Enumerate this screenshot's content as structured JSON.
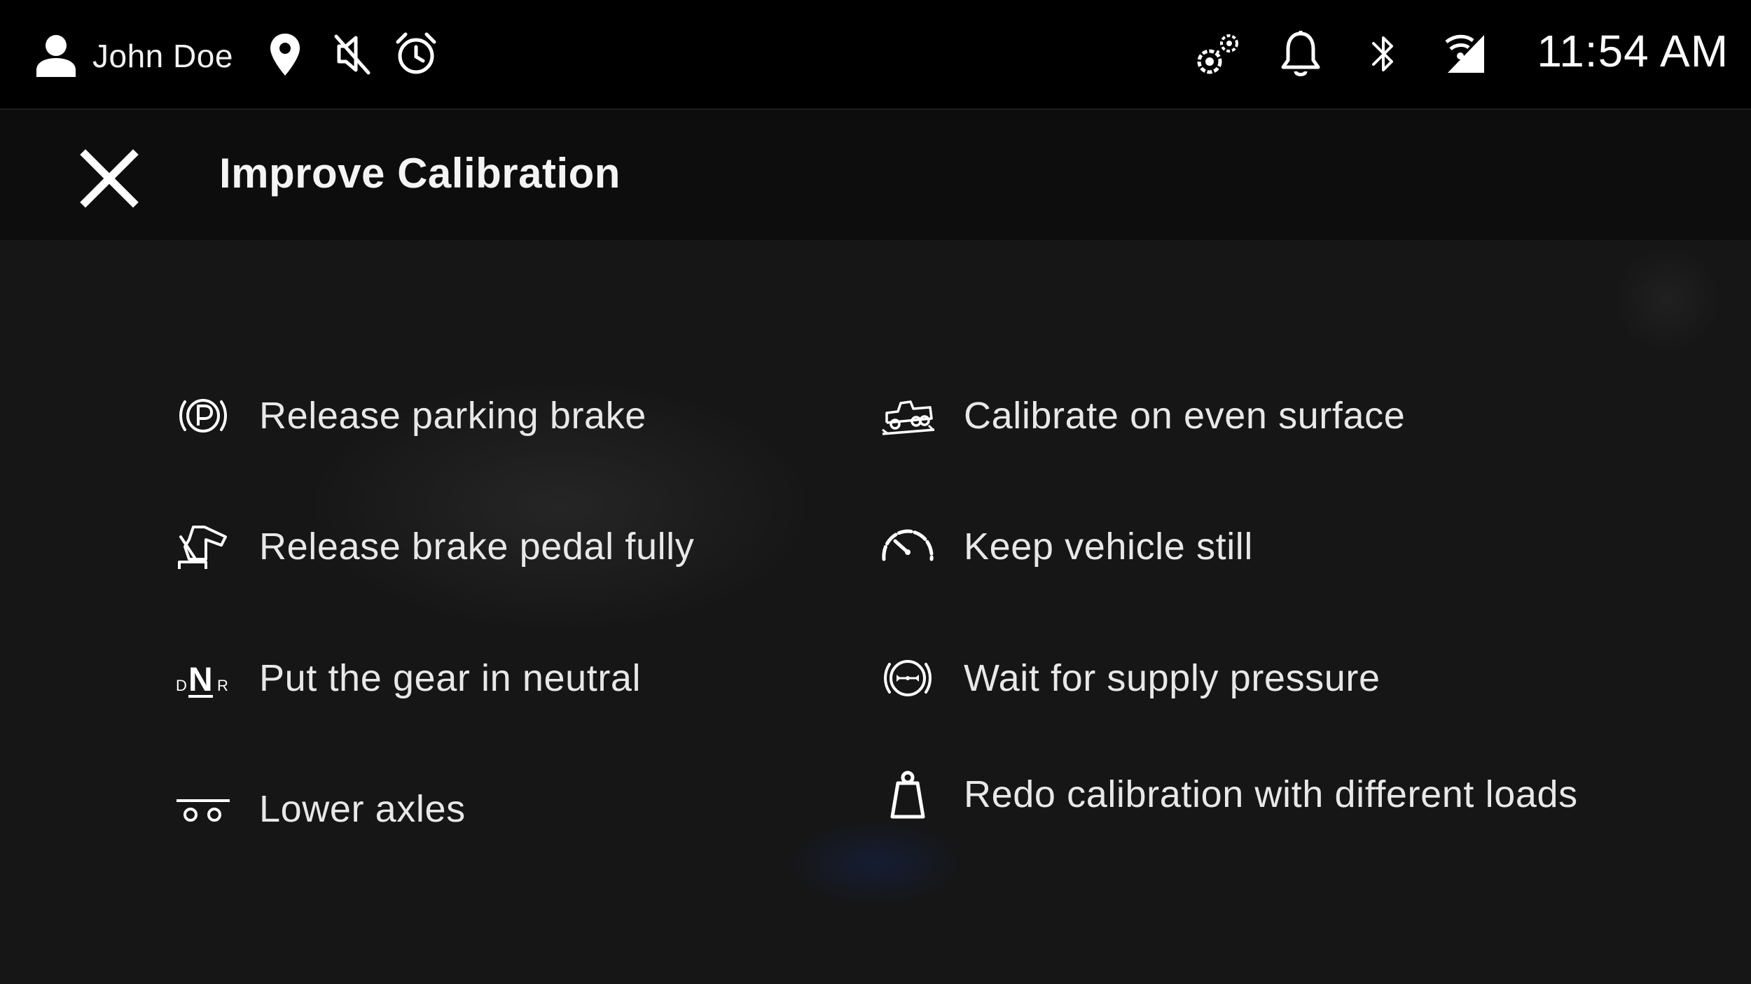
{
  "status_bar": {
    "user_name": "John Doe",
    "time": "11:54 AM",
    "icons": [
      "person-icon",
      "location-pin-icon",
      "muted-speaker-icon",
      "alarm-clock-icon",
      "settings-gears-icon",
      "bell-icon",
      "bluetooth-icon",
      "wifi-cellular-icon"
    ]
  },
  "header": {
    "title": "Improve Calibration",
    "close_icon": "close-icon"
  },
  "instructions": {
    "left": [
      {
        "icon": "parking-brake-icon",
        "label": "Release parking brake"
      },
      {
        "icon": "brake-pedal-icon",
        "label": "Release brake pedal fully"
      },
      {
        "icon": "gear-neutral-icon",
        "label": "Put the gear in neutral"
      },
      {
        "icon": "axles-icon",
        "label": "Lower axles"
      }
    ],
    "right": [
      {
        "icon": "even-surface-icon",
        "label": "Calibrate on even surface"
      },
      {
        "icon": "speedometer-icon",
        "label": "Keep vehicle still"
      },
      {
        "icon": "supply-pressure-icon",
        "label": "Wait for supply pressure"
      },
      {
        "icon": "load-weight-icon",
        "label": "Redo calibration with different loads"
      }
    ]
  },
  "colors": {
    "status_bar_bg": "#000000",
    "header_bg": "#0d0d0d",
    "content_bg": "#161616",
    "text": "#e8e8e8"
  }
}
